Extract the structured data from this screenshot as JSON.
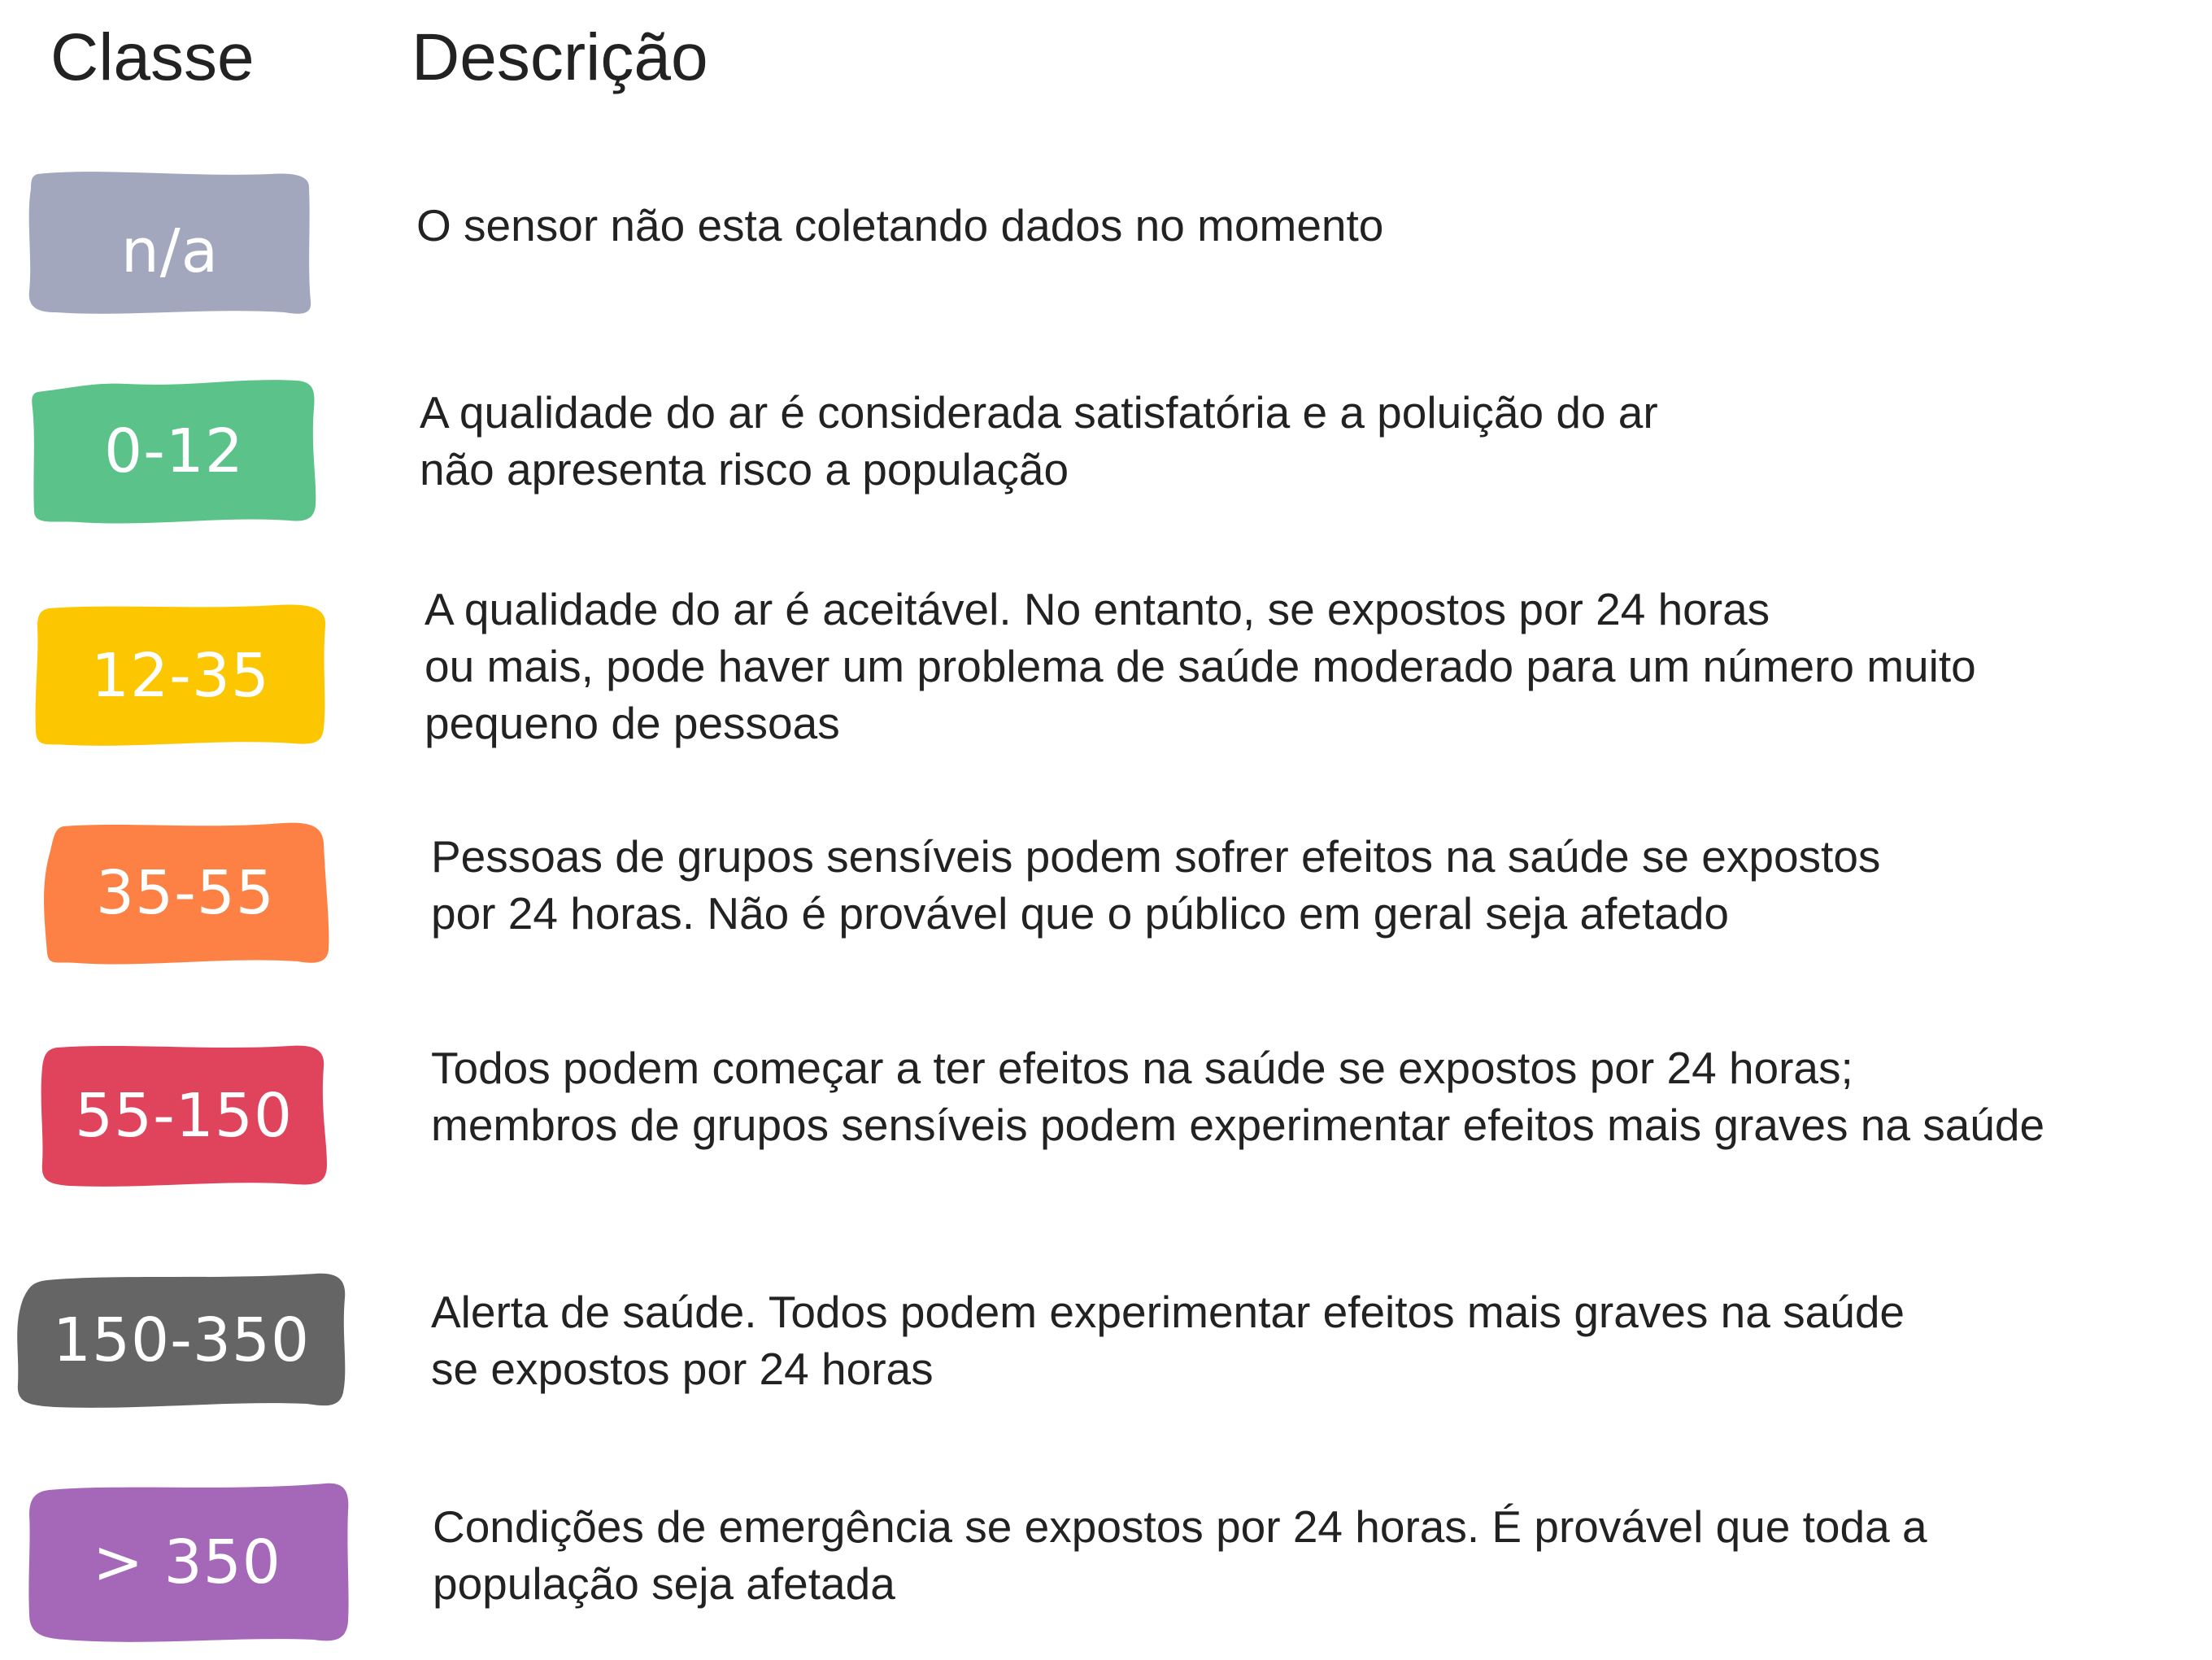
{
  "headers": {
    "classe": "Classe",
    "descricao": "Descrição"
  },
  "rows": [
    {
      "label": "n/a",
      "color": "#A3A7BE",
      "lines": [
        "O sensor não esta coletando dados no momento"
      ]
    },
    {
      "label": "0-12",
      "color": "#5BC38A",
      "lines": [
        "A qualidade do ar é considerada satisfatória e a poluição do ar",
        "não apresenta risco a população"
      ]
    },
    {
      "label": "12-35",
      "color": "#FCC600",
      "lines": [
        "A qualidade do ar é aceitável. No entanto, se expostos por 24 horas",
        "ou mais, pode haver um problema de saúde moderado para um número muito",
        "pequeno de pessoas"
      ]
    },
    {
      "label": "35-55",
      "color": "#FD8145",
      "lines": [
        "Pessoas de grupos sensíveis podem sofrer efeitos na saúde se expostos",
        "por 24 horas. Não é provável que o público em geral seja afetado"
      ]
    },
    {
      "label": "55-150",
      "color": "#E0445C",
      "lines": [
        "Todos podem começar a ter efeitos na saúde se expostos por 24 horas;",
        "membros de grupos sensíveis podem experimentar efeitos mais graves na saúde"
      ]
    },
    {
      "label": "150-350",
      "color": "#656565",
      "lines": [
        "Alerta de saúde. Todos podem experimentar efeitos mais graves na saúde",
        "se expostos por 24 horas"
      ]
    },
    {
      "label": "> 350",
      "color": "#A568B8",
      "lines": [
        "Condições de emergência se expostos por 24 horas. É provável que toda a",
        "população seja afetada"
      ]
    }
  ]
}
